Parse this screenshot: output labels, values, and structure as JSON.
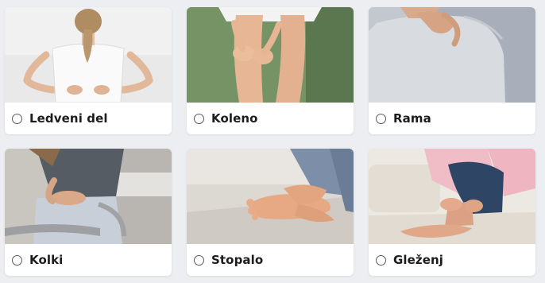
{
  "options": [
    {
      "label": "Ledveni del",
      "icon": "lower-back-pain-photo"
    },
    {
      "label": "Koleno",
      "icon": "knee-pain-photo"
    },
    {
      "label": "Rama",
      "icon": "shoulder-pain-photo"
    },
    {
      "label": "Kolki",
      "icon": "hip-pain-photo"
    },
    {
      "label": "Stopalo",
      "icon": "foot-pain-photo"
    },
    {
      "label": "Gleženj",
      "icon": "ankle-pain-photo"
    }
  ],
  "colors": {
    "page_background": "#eceef1",
    "card_background": "#ffffff",
    "label_text": "#1c1c1c",
    "radio_border": "#5a5a5a"
  }
}
